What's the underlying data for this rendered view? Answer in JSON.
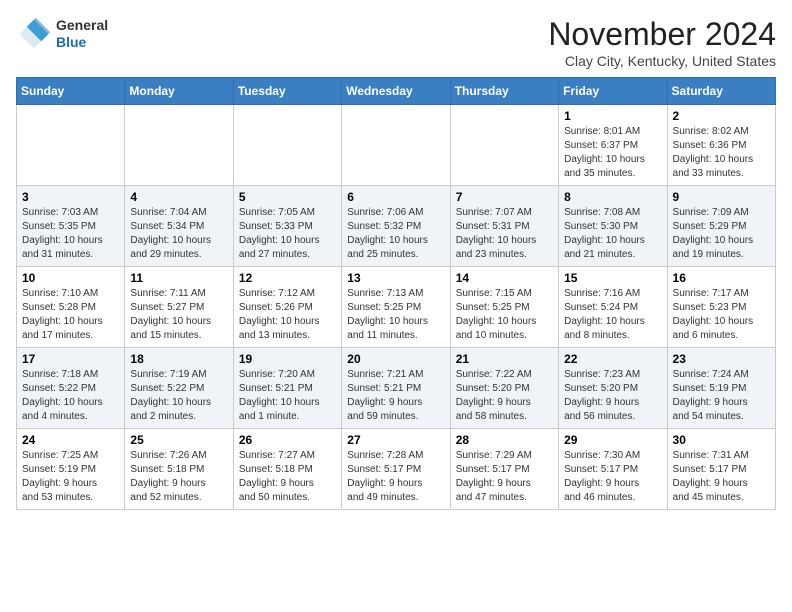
{
  "header": {
    "logo_general": "General",
    "logo_blue": "Blue",
    "month_year": "November 2024",
    "location": "Clay City, Kentucky, United States"
  },
  "weekdays": [
    "Sunday",
    "Monday",
    "Tuesday",
    "Wednesday",
    "Thursday",
    "Friday",
    "Saturday"
  ],
  "weeks": [
    [
      {
        "day": "",
        "info": ""
      },
      {
        "day": "",
        "info": ""
      },
      {
        "day": "",
        "info": ""
      },
      {
        "day": "",
        "info": ""
      },
      {
        "day": "",
        "info": ""
      },
      {
        "day": "1",
        "info": "Sunrise: 8:01 AM\nSunset: 6:37 PM\nDaylight: 10 hours\nand 35 minutes."
      },
      {
        "day": "2",
        "info": "Sunrise: 8:02 AM\nSunset: 6:36 PM\nDaylight: 10 hours\nand 33 minutes."
      }
    ],
    [
      {
        "day": "3",
        "info": "Sunrise: 7:03 AM\nSunset: 5:35 PM\nDaylight: 10 hours\nand 31 minutes."
      },
      {
        "day": "4",
        "info": "Sunrise: 7:04 AM\nSunset: 5:34 PM\nDaylight: 10 hours\nand 29 minutes."
      },
      {
        "day": "5",
        "info": "Sunrise: 7:05 AM\nSunset: 5:33 PM\nDaylight: 10 hours\nand 27 minutes."
      },
      {
        "day": "6",
        "info": "Sunrise: 7:06 AM\nSunset: 5:32 PM\nDaylight: 10 hours\nand 25 minutes."
      },
      {
        "day": "7",
        "info": "Sunrise: 7:07 AM\nSunset: 5:31 PM\nDaylight: 10 hours\nand 23 minutes."
      },
      {
        "day": "8",
        "info": "Sunrise: 7:08 AM\nSunset: 5:30 PM\nDaylight: 10 hours\nand 21 minutes."
      },
      {
        "day": "9",
        "info": "Sunrise: 7:09 AM\nSunset: 5:29 PM\nDaylight: 10 hours\nand 19 minutes."
      }
    ],
    [
      {
        "day": "10",
        "info": "Sunrise: 7:10 AM\nSunset: 5:28 PM\nDaylight: 10 hours\nand 17 minutes."
      },
      {
        "day": "11",
        "info": "Sunrise: 7:11 AM\nSunset: 5:27 PM\nDaylight: 10 hours\nand 15 minutes."
      },
      {
        "day": "12",
        "info": "Sunrise: 7:12 AM\nSunset: 5:26 PM\nDaylight: 10 hours\nand 13 minutes."
      },
      {
        "day": "13",
        "info": "Sunrise: 7:13 AM\nSunset: 5:25 PM\nDaylight: 10 hours\nand 11 minutes."
      },
      {
        "day": "14",
        "info": "Sunrise: 7:15 AM\nSunset: 5:25 PM\nDaylight: 10 hours\nand 10 minutes."
      },
      {
        "day": "15",
        "info": "Sunrise: 7:16 AM\nSunset: 5:24 PM\nDaylight: 10 hours\nand 8 minutes."
      },
      {
        "day": "16",
        "info": "Sunrise: 7:17 AM\nSunset: 5:23 PM\nDaylight: 10 hours\nand 6 minutes."
      }
    ],
    [
      {
        "day": "17",
        "info": "Sunrise: 7:18 AM\nSunset: 5:22 PM\nDaylight: 10 hours\nand 4 minutes."
      },
      {
        "day": "18",
        "info": "Sunrise: 7:19 AM\nSunset: 5:22 PM\nDaylight: 10 hours\nand 2 minutes."
      },
      {
        "day": "19",
        "info": "Sunrise: 7:20 AM\nSunset: 5:21 PM\nDaylight: 10 hours\nand 1 minute."
      },
      {
        "day": "20",
        "info": "Sunrise: 7:21 AM\nSunset: 5:21 PM\nDaylight: 9 hours\nand 59 minutes."
      },
      {
        "day": "21",
        "info": "Sunrise: 7:22 AM\nSunset: 5:20 PM\nDaylight: 9 hours\nand 58 minutes."
      },
      {
        "day": "22",
        "info": "Sunrise: 7:23 AM\nSunset: 5:20 PM\nDaylight: 9 hours\nand 56 minutes."
      },
      {
        "day": "23",
        "info": "Sunrise: 7:24 AM\nSunset: 5:19 PM\nDaylight: 9 hours\nand 54 minutes."
      }
    ],
    [
      {
        "day": "24",
        "info": "Sunrise: 7:25 AM\nSunset: 5:19 PM\nDaylight: 9 hours\nand 53 minutes."
      },
      {
        "day": "25",
        "info": "Sunrise: 7:26 AM\nSunset: 5:18 PM\nDaylight: 9 hours\nand 52 minutes."
      },
      {
        "day": "26",
        "info": "Sunrise: 7:27 AM\nSunset: 5:18 PM\nDaylight: 9 hours\nand 50 minutes."
      },
      {
        "day": "27",
        "info": "Sunrise: 7:28 AM\nSunset: 5:17 PM\nDaylight: 9 hours\nand 49 minutes."
      },
      {
        "day": "28",
        "info": "Sunrise: 7:29 AM\nSunset: 5:17 PM\nDaylight: 9 hours\nand 47 minutes."
      },
      {
        "day": "29",
        "info": "Sunrise: 7:30 AM\nSunset: 5:17 PM\nDaylight: 9 hours\nand 46 minutes."
      },
      {
        "day": "30",
        "info": "Sunrise: 7:31 AM\nSunset: 5:17 PM\nDaylight: 9 hours\nand 45 minutes."
      }
    ]
  ]
}
